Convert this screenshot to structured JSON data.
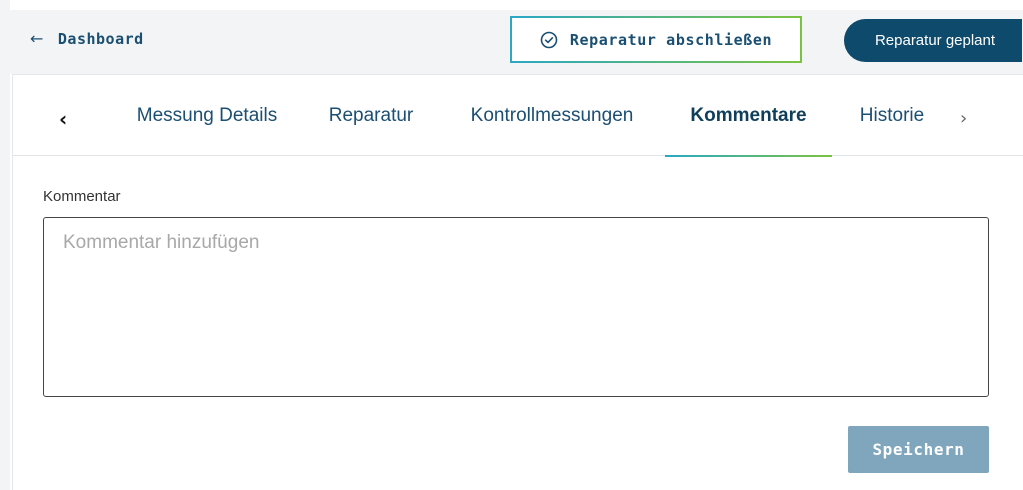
{
  "header": {
    "back_label": "Dashboard",
    "back_icon": "arrow-left-icon",
    "complete_label": "Reparatur abschließen",
    "complete_icon": "check-circle-icon",
    "planned_label": "Reparatur geplant"
  },
  "tabs": {
    "prev_icon": "chevron-left-icon",
    "next_icon": "chevron-right-icon",
    "items": [
      {
        "label": "Messung Details",
        "active": false
      },
      {
        "label": "Reparatur",
        "active": false
      },
      {
        "label": "Kontrollmessungen",
        "active": false
      },
      {
        "label": "Kommentare",
        "active": true
      },
      {
        "label": "Historie",
        "active": false
      }
    ]
  },
  "comment": {
    "label": "Kommentar",
    "value": "",
    "placeholder": "Kommentar hinzufügen"
  },
  "actions": {
    "save_label": "Speichern"
  },
  "colors": {
    "primary": "#0e4a6b",
    "text_primary": "#1b4f72",
    "accent_gradient_start": "#2aa8c4",
    "accent_gradient_end": "#7cc242",
    "save_disabled": "#7fa6bd",
    "background": "#f3f4f6"
  }
}
